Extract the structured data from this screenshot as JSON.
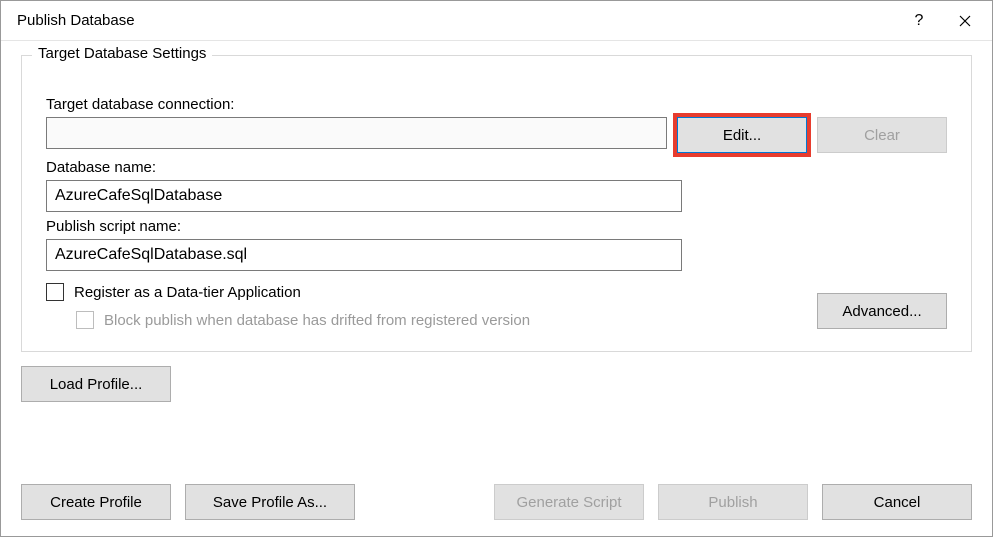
{
  "window": {
    "title": "Publish Database"
  },
  "group": {
    "legend": "Target Database Settings"
  },
  "fields": {
    "conn_label": "Target database connection:",
    "conn_value": "",
    "dbname_label": "Database name:",
    "dbname_value": "AzureCafeSqlDatabase",
    "script_label": "Publish script name:",
    "script_value": "AzureCafeSqlDatabase.sql"
  },
  "buttons": {
    "edit": "Edit...",
    "clear": "Clear",
    "advanced": "Advanced...",
    "load_profile": "Load Profile...",
    "create_profile": "Create Profile",
    "save_profile_as": "Save Profile As...",
    "generate_script": "Generate Script",
    "publish": "Publish",
    "cancel": "Cancel",
    "help": "?"
  },
  "checks": {
    "register": "Register as a Data-tier Application",
    "block": "Block publish when database has drifted from registered version"
  }
}
